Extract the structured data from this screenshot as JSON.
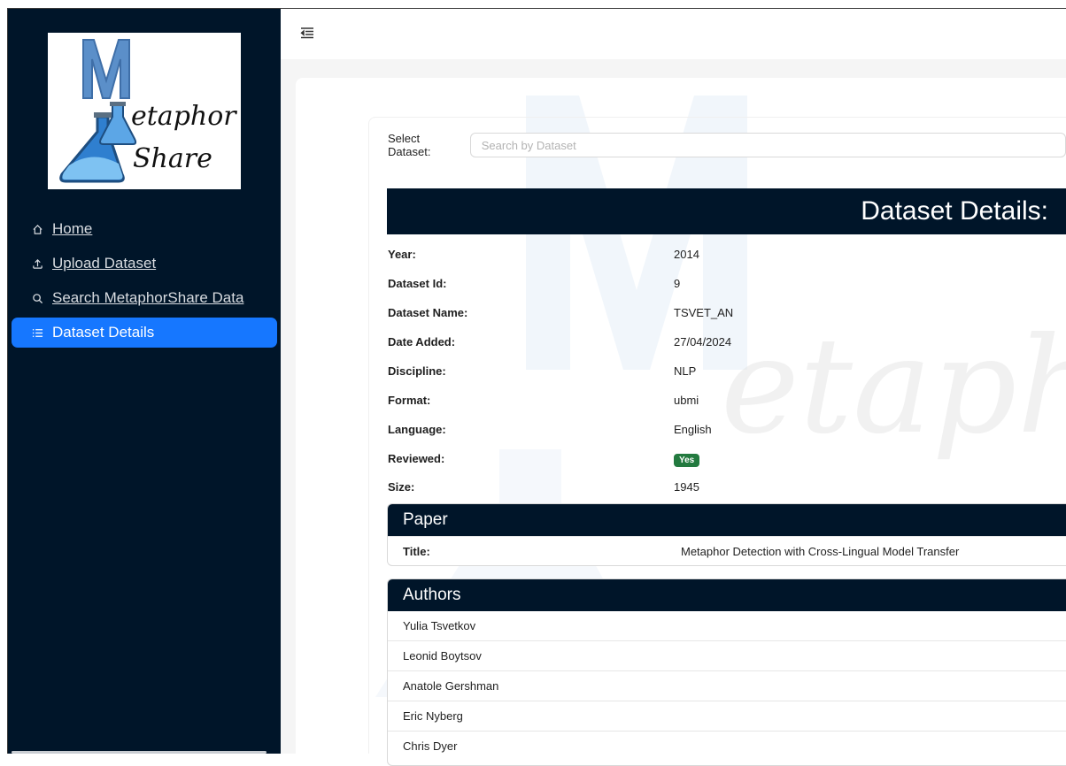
{
  "brand": {
    "logo_text_1": "etaphor",
    "logo_text_2": "Share",
    "logo_letter": "M"
  },
  "sidebar": {
    "items": [
      {
        "label": "Home",
        "icon": "home-icon",
        "active": false
      },
      {
        "label": "Upload Dataset",
        "icon": "upload-icon",
        "active": false
      },
      {
        "label": "Search MetaphorShare Data",
        "icon": "search-icon",
        "active": false
      },
      {
        "label": "Dataset Details",
        "icon": "list-icon",
        "active": true
      }
    ]
  },
  "search": {
    "label": "Select Dataset",
    "colon": ":",
    "placeholder": "Search by Dataset"
  },
  "details": {
    "title": "Dataset Details:",
    "fields": [
      {
        "key": "Year:",
        "value": "2014"
      },
      {
        "key": "Dataset Id:",
        "value": "9"
      },
      {
        "key": "Dataset Name:",
        "value": "TSVET_AN"
      },
      {
        "key": "Date Added:",
        "value": "27/04/2024"
      },
      {
        "key": "Discipline:",
        "value": "NLP"
      },
      {
        "key": "Format:",
        "value": "ubmi"
      },
      {
        "key": "Language:",
        "value": "English"
      },
      {
        "key": "Reviewed:",
        "value": "Yes",
        "badge": true
      },
      {
        "key": "Size:",
        "value": "1945"
      }
    ]
  },
  "paper": {
    "heading": "Paper",
    "title_key": "Title:",
    "title_value": "Metaphor Detection with Cross-Lingual Model Transfer"
  },
  "authors": {
    "heading": "Authors",
    "list": [
      "Yulia Tsvetkov",
      "Leonid Boytsov",
      "Anatole Gershman",
      "Eric Nyberg",
      "Chris Dyer"
    ]
  },
  "colors": {
    "sidebar_bg": "#001529",
    "accent": "#1677ff",
    "badge_green": "#237a3f"
  }
}
